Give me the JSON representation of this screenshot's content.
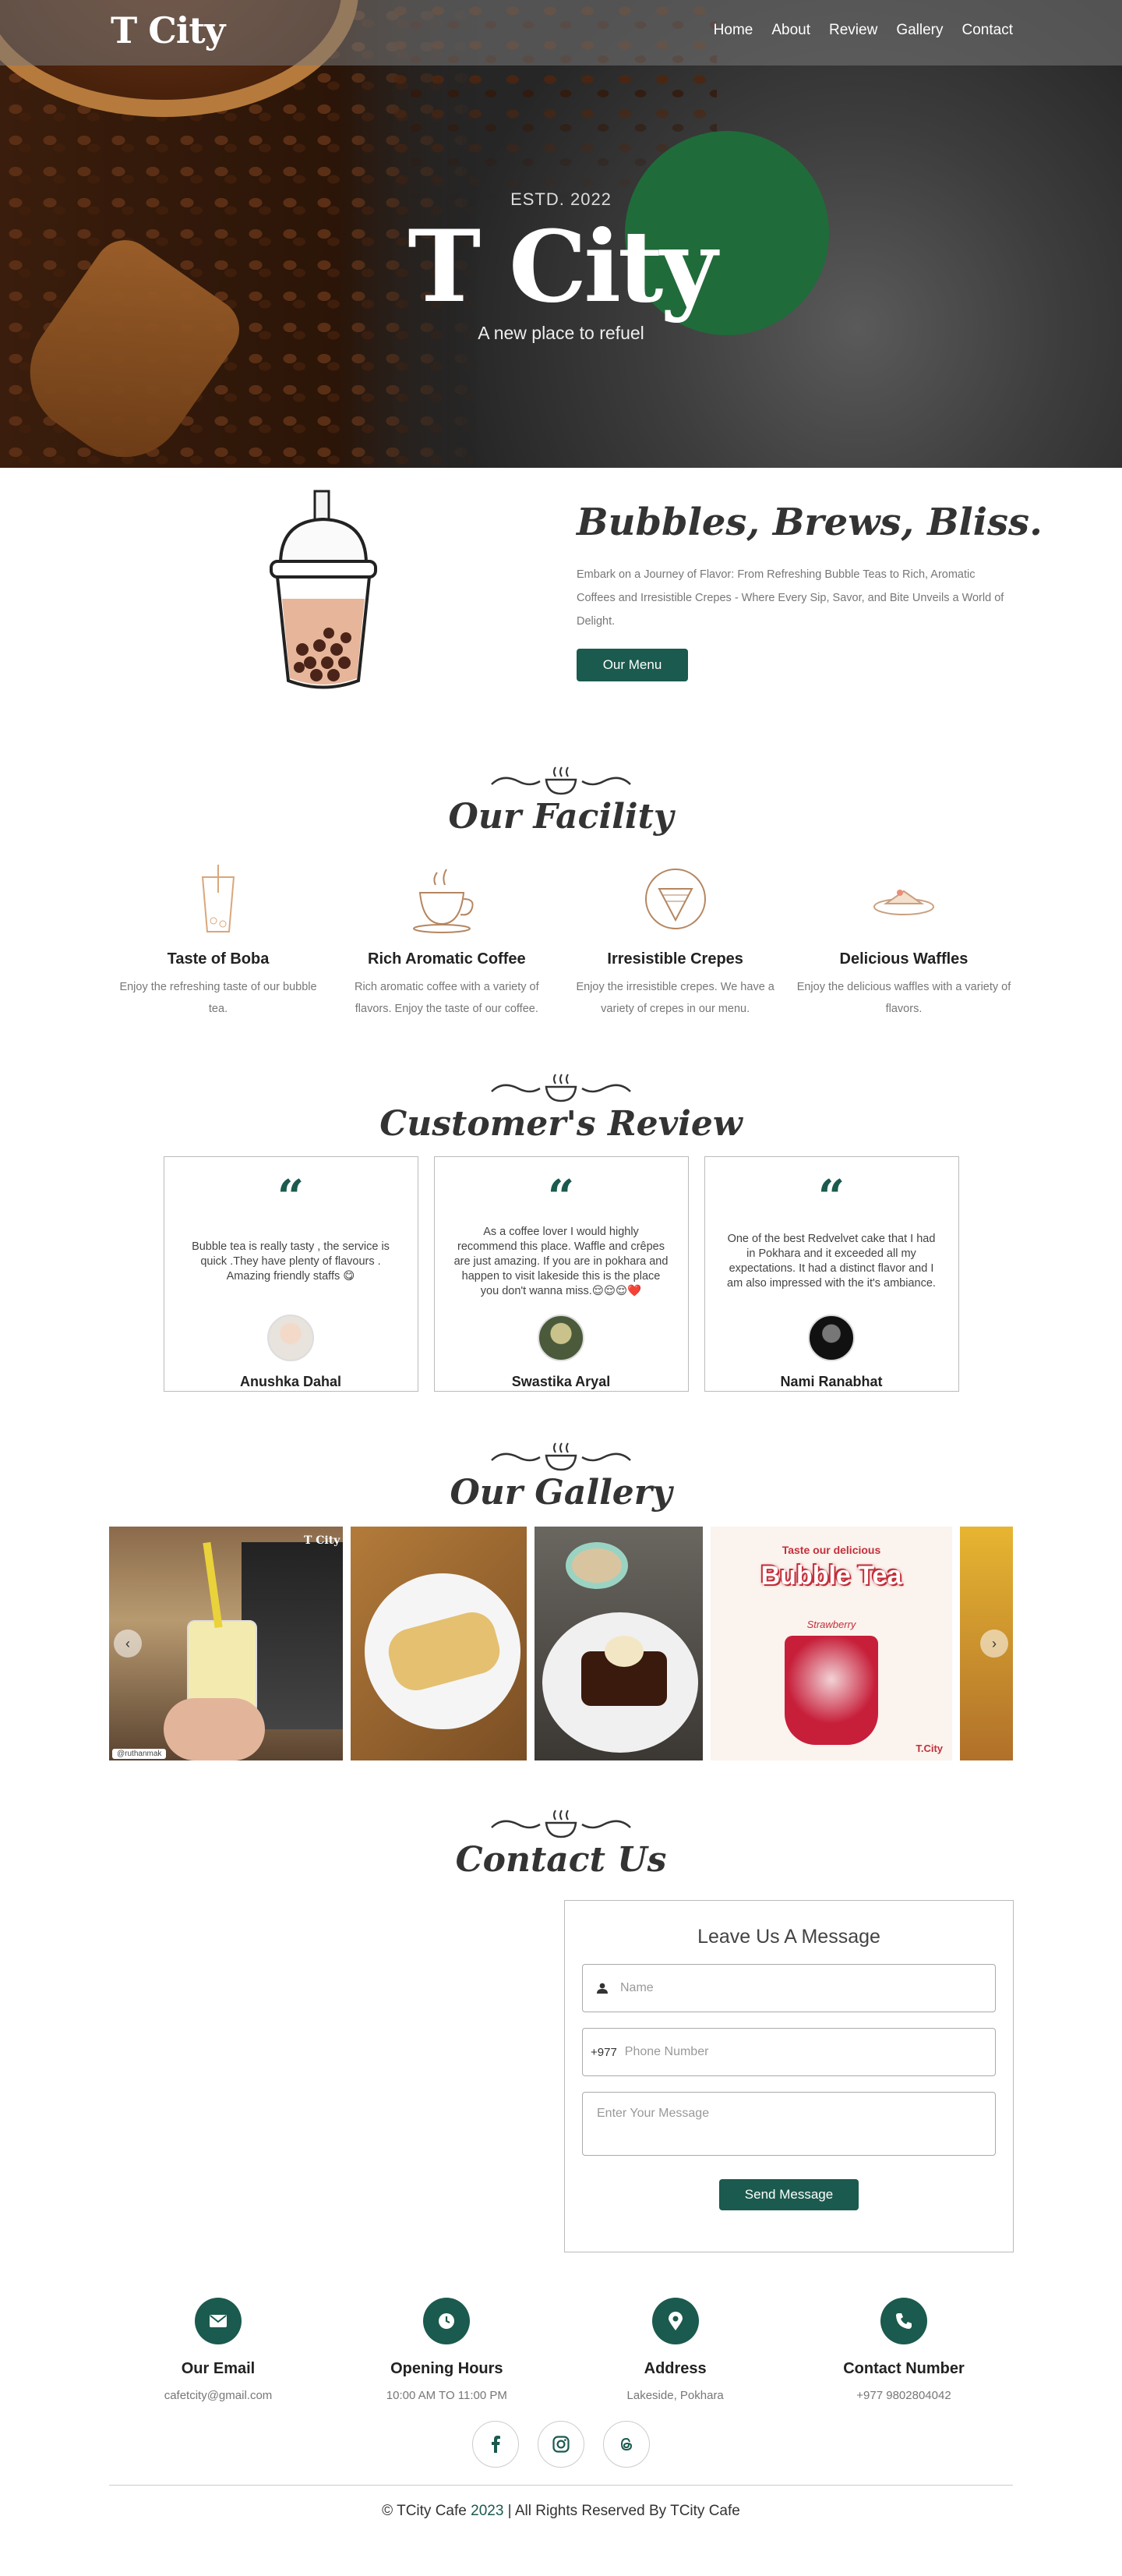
{
  "nav": {
    "brand": "T City",
    "items": [
      "Home",
      "About",
      "Review",
      "Gallery",
      "Contact"
    ]
  },
  "hero": {
    "estd": "ESTD. 2022",
    "title": "T City",
    "tagline": "A new place to refuel"
  },
  "intro": {
    "heading": "Bubbles, Brews, Bliss.",
    "text": "Embark on a Journey of Flavor: From Refreshing Bubble Teas to Rich, Aromatic Coffees and Irresistible Crepes - Where Every Sip, Savor, and Bite Unveils a World of Delight.",
    "button": "Our Menu"
  },
  "facility": {
    "title": "Our Facility",
    "items": [
      {
        "name": "Taste of Boba",
        "desc": "Enjoy the refreshing taste of our bubble tea.",
        "icon": "boba-sketch-icon"
      },
      {
        "name": "Rich Aromatic Coffee",
        "desc": "Rich aromatic coffee with a variety of flavors. Enjoy the taste of our coffee.",
        "icon": "coffee-cup-sketch-icon"
      },
      {
        "name": "Irresistible Crepes",
        "desc": "Enjoy the irresistible crepes. We have a variety of crepes in our menu.",
        "icon": "crepe-sketch-icon"
      },
      {
        "name": "Delicious Waffles",
        "desc": "Enjoy the delicious waffles with a variety of flavors.",
        "icon": "waffle-sketch-icon"
      }
    ]
  },
  "reviews": {
    "title": "Customer's Review",
    "items": [
      {
        "text": "Bubble tea is really tasty , the service is quick .They have plenty of flavours . Amazing friendly staffs 😋",
        "name": "Anushka Dahal"
      },
      {
        "text": "As a coffee lover I would highly recommend this place. Waffle and crêpes are just amazing. If you are in pokhara and happen to visit lakeside this is the place you don't wanna miss.😌😌😌❤️",
        "name": "Swastika Aryal"
      },
      {
        "text": "One of the best Redvelvet cake that I had in Pokhara and it exceeded all my expectations. It had a distinct flavor and I am also impressed with the it's ambiance.",
        "name": "Nami Ranabhat"
      }
    ]
  },
  "gallery": {
    "title": "Our Gallery",
    "photo1_logo": "T City",
    "photo1_handle": "@ruthanmak",
    "poster_top": "Taste our delicious",
    "poster_title": "Bubble Tea",
    "poster_flavor": "Strawberry",
    "poster_logo": "T.City"
  },
  "contact": {
    "title": "Contact Us",
    "form_title": "Leave Us A Message",
    "name_placeholder": "Name",
    "phone_prefix": "+977",
    "phone_placeholder": "Phone Number",
    "message_placeholder": "Enter Your Message",
    "button": "Send Message"
  },
  "info": [
    {
      "title": "Our Email",
      "value": "cafetcity@gmail.com",
      "icon": "envelope-icon"
    },
    {
      "title": "Opening Hours",
      "value": "10:00 AM TO 11:00 PM",
      "icon": "clock-icon"
    },
    {
      "title": "Address",
      "value": "Lakeside, Pokhara",
      "icon": "map-pin-icon"
    },
    {
      "title": "Contact Number",
      "value": "+977 9802804042",
      "icon": "phone-icon"
    }
  ],
  "footer": {
    "prefix": "© TCity Cafe ",
    "year": "2023",
    "suffix": " | All Rights Reserved By TCity Cafe"
  },
  "colors": {
    "accent": "#1b5a4e",
    "hero_circle": "#206b3a"
  }
}
